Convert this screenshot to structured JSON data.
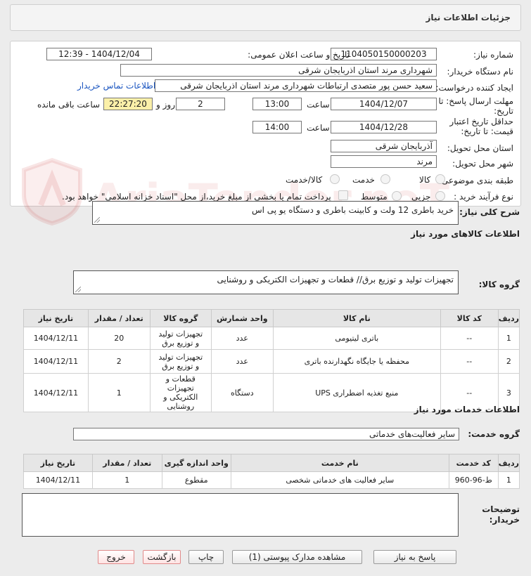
{
  "header": {
    "title": "جزئیات اطلاعات نیاز"
  },
  "watermark": {
    "text": "AriaTender.neT"
  },
  "form": {
    "need_number_label": "شماره نیاز:",
    "need_number": "1104050150000203",
    "announce_label": "تاریخ و ساعت اعلان عمومی:",
    "announce_value": "1404/12/04 - 12:39",
    "buyer_org_label": "نام دستگاه خریدار:",
    "buyer_org": "شهرداری مرند استان اذربایجان شرقی",
    "creator_label": "ایجاد کننده درخواست:",
    "creator": "سعید حسن پور متصدی ارتباطات شهرداری مرند استان اذربایجان شرقی",
    "contact_link": "اطلاعات تماس خریدار",
    "deadline_label_1": "مهلت ارسال پاسخ: تا",
    "deadline_label_2": "تاریخ:",
    "deadline_date": "1404/12/07",
    "time_label": "ساعت",
    "deadline_time": "13:00",
    "days_value": "2",
    "days_label": "روز و",
    "remaining_time": "22:27:20",
    "remaining_label": "ساعت باقی مانده",
    "validity_label_1": "حداقل تاریخ اعتبار",
    "validity_label_2": "قیمت: تا تاریخ:",
    "validity_date": "1404/12/28",
    "validity_time": "14:00",
    "province_label": "استان محل تحویل:",
    "province": "آذربایجان شرقی",
    "city_label": "شهر محل تحویل:",
    "city": "مرند",
    "category_label": "طبقه بندی موضوعی:",
    "category_options": [
      "کالا",
      "خدمت",
      "کالا/خدمت"
    ],
    "process_label": "نوع فرآیند خرید :",
    "process_options": [
      "جزیی",
      "متوسط"
    ],
    "payment_note": "پرداخت تمام یا بخشی از مبلغ خرید،از محل \"اسناد خزانه اسلامی\" خواهد بود."
  },
  "description": {
    "label": "شرح کلی نیاز:",
    "value": "خرید باطری 12 ولت و کابینت باطری و دستگاه یو پی اس"
  },
  "goods": {
    "section_title": "اطلاعات کالاهای مورد نیاز",
    "group_label": "گروه کالا:",
    "group_value": "تجهیزات تولید و توزیع برق// قطعات و تجهیزات الکتریکی و روشنایی",
    "headers": [
      "ردیف",
      "کد کالا",
      "نام کالا",
      "واحد شمارش",
      "گروه کالا",
      "تعداد / مقدار",
      "تاریخ نیاز"
    ],
    "rows": [
      {
        "row": "1",
        "code": "--",
        "name": "باتری لیتیومی",
        "unit": "عدد",
        "group": "تجهیزات تولید و توزیع برق",
        "qty": "20",
        "date": "1404/12/11"
      },
      {
        "row": "2",
        "code": "--",
        "name": "محفظه یا جایگاه نگهدارنده باتری",
        "unit": "عدد",
        "group": "تجهیزات تولید و توزیع برق",
        "qty": "2",
        "date": "1404/12/11"
      },
      {
        "row": "3",
        "code": "--",
        "name": "منبع تغذیه اضطراری UPS",
        "unit": "دستگاه",
        "group": "قطعات و تجهیزات الکتریکی و روشنایی",
        "qty": "1",
        "date": "1404/12/11"
      }
    ]
  },
  "services": {
    "section_title": "اطلاعات خدمات مورد نیاز",
    "group_label": "گروه خدمت:",
    "group_value": "سایر فعالیت‌های خدماتی",
    "headers": [
      "ردیف",
      "کد خدمت",
      "نام خدمت",
      "واحد اندازه گیری",
      "تعداد / مقدار",
      "تاریخ نیاز"
    ],
    "rows": [
      {
        "row": "1",
        "code": "ط-96-960",
        "name": "سایر فعالیت های خدماتی شخصی",
        "unit": "مقطوع",
        "qty": "1",
        "date": "1404/12/11"
      }
    ]
  },
  "buyer_notes": {
    "label_1": "توضیحات",
    "label_2": "خریدار:",
    "value": ""
  },
  "buttons": {
    "reply": "پاسخ به نیاز",
    "attachments": "مشاهده مدارک پیوستی (1)",
    "print": "چاپ",
    "back": "بازگشت",
    "exit": "خروج"
  }
}
